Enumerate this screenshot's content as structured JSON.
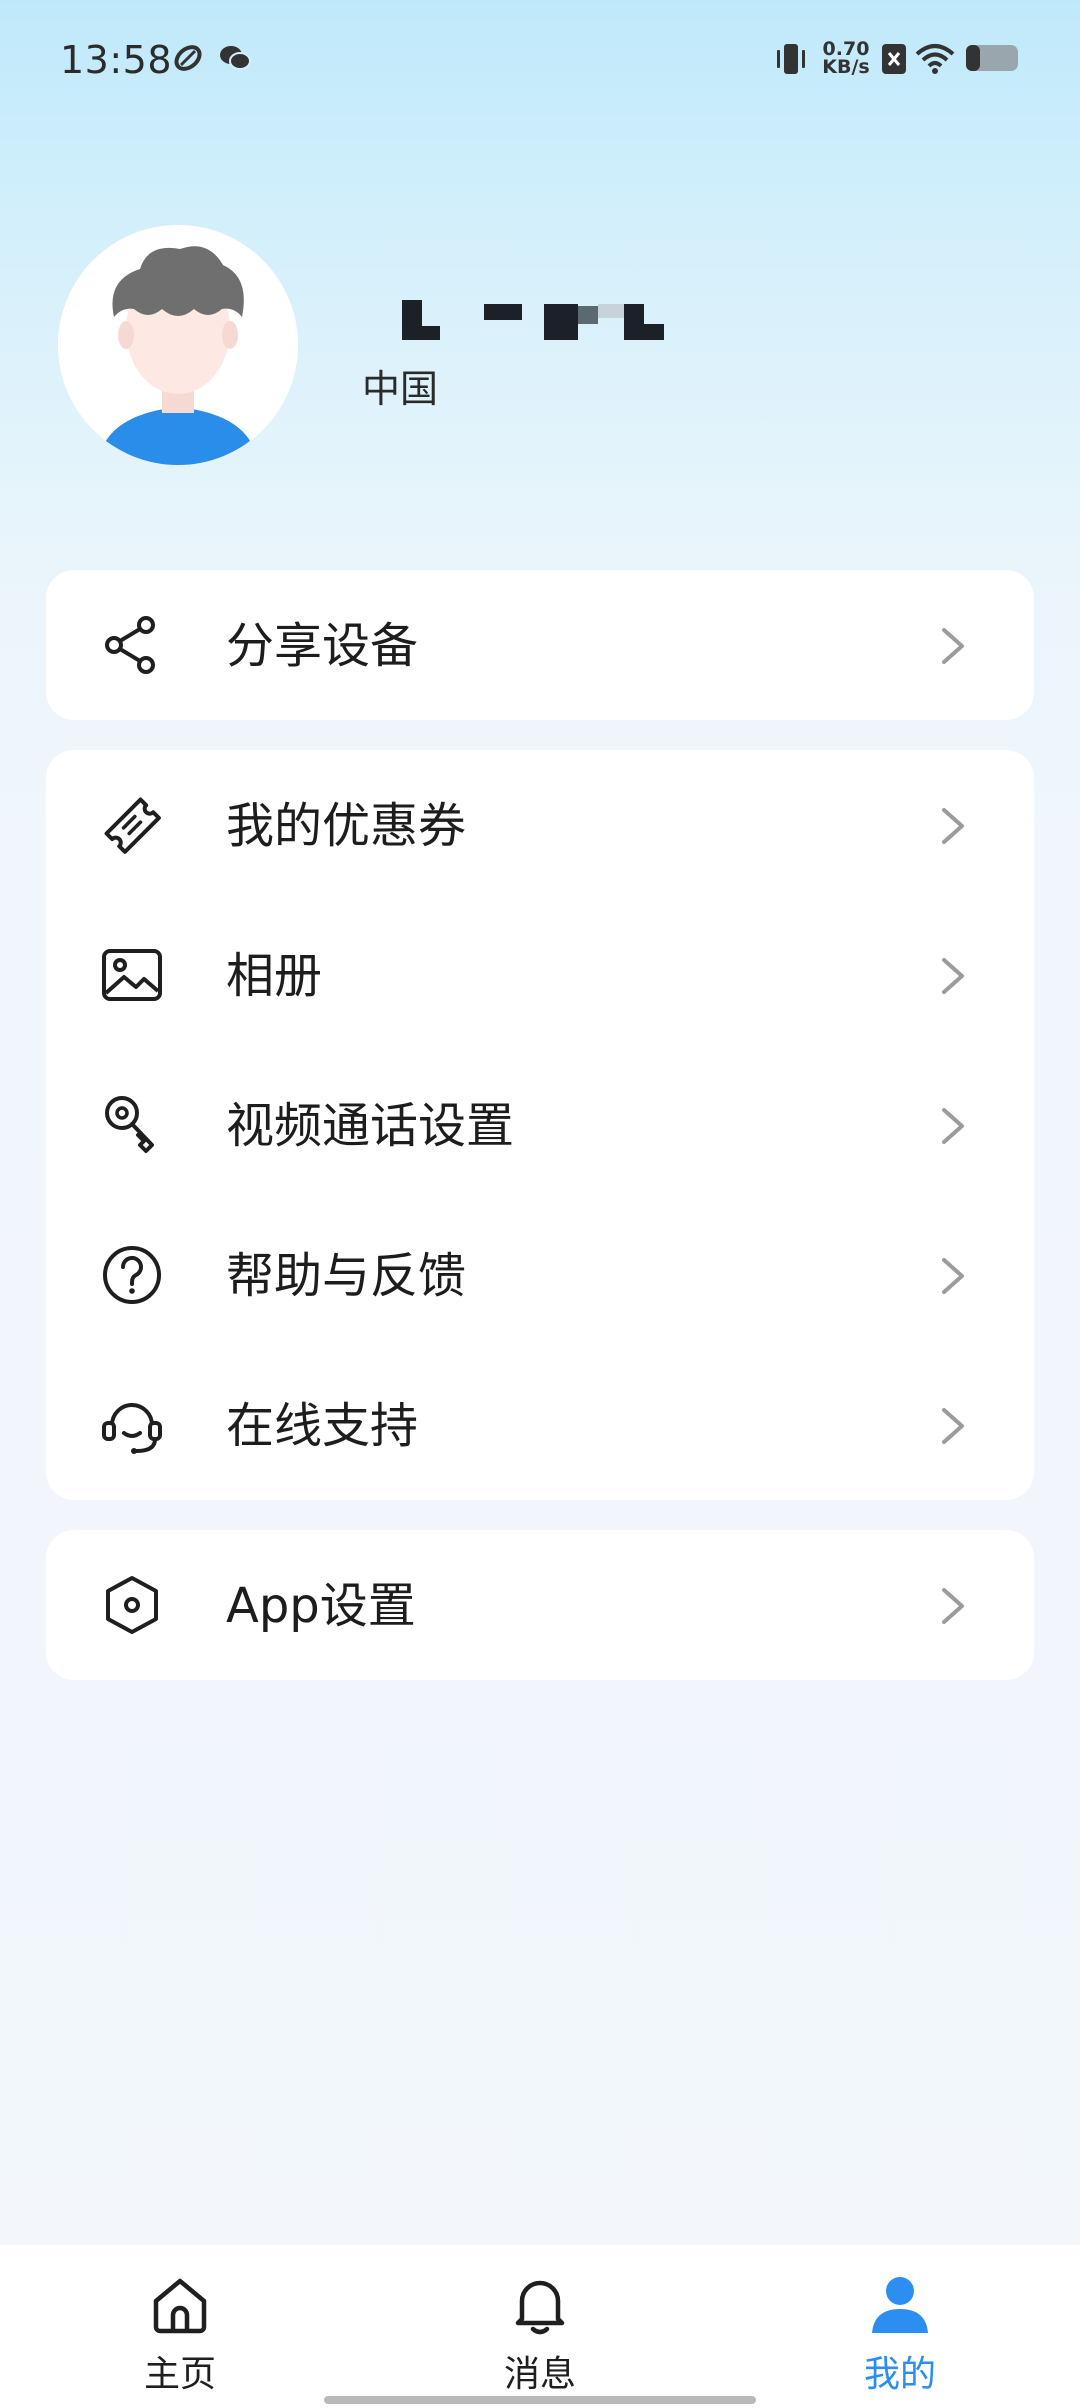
{
  "status_bar": {
    "time": "13:58",
    "net_speed_value": "0.70",
    "net_speed_unit": "KB/s"
  },
  "profile": {
    "region": "中国"
  },
  "menu": {
    "share_device": "分享设备",
    "coupons": "我的优惠券",
    "album": "相册",
    "video_call_settings": "视频通话设置",
    "help_feedback": "帮助与反馈",
    "online_support": "在线支持",
    "app_settings": "App设置"
  },
  "bottom_nav": {
    "home": "主页",
    "messages": "消息",
    "mine": "我的",
    "active_color": "#2b8ef0"
  }
}
